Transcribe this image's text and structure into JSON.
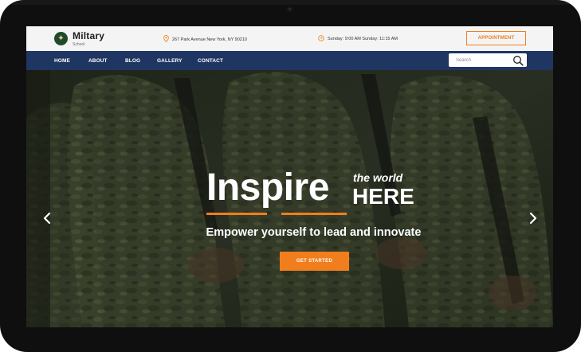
{
  "brand": {
    "name": "Miltary",
    "subtitle": "School"
  },
  "topbar": {
    "address": "267 Park Avenue New York, NY 90210",
    "hours": "Sunday: 9:00 AM Sunday: 11:15 AM",
    "appointment_label": "APPOINTMENT",
    "address_icon": "map-pin-icon",
    "hours_icon": "clock-icon"
  },
  "nav": {
    "items": [
      {
        "label": "HOME"
      },
      {
        "label": "ABOUT"
      },
      {
        "label": "BLOG"
      },
      {
        "label": "GALLERY"
      },
      {
        "label": "CONTACT"
      }
    ]
  },
  "search": {
    "placeholder": "Search",
    "icon": "search-icon"
  },
  "hero": {
    "headline_main": "Inspire",
    "headline_small": "the world",
    "headline_here": "HERE",
    "tagline": "Empower yourself to lead and innovate",
    "cta_label": "GET STARTED",
    "prev_icon": "chevron-left-icon",
    "next_icon": "chevron-right-icon"
  },
  "colors": {
    "accent": "#f07e1d",
    "navbar": "#1f3662",
    "topbar": "#f4f4f4",
    "logo_badge": "#21492a"
  }
}
